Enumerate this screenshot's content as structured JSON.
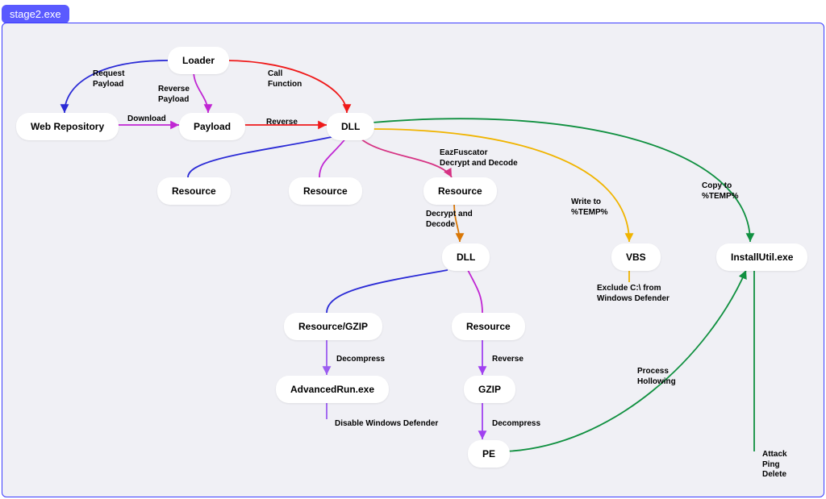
{
  "title": "stage2.exe",
  "nodes": {
    "loader": "Loader",
    "webrepo": "Web Repository",
    "payload": "Payload",
    "dll1": "DLL",
    "res1": "Resource",
    "res2": "Resource",
    "res3": "Resource",
    "dll2": "DLL",
    "resgzip": "Resource/GZIP",
    "res4": "Resource",
    "advrun": "AdvancedRun.exe",
    "gzip": "GZIP",
    "pe": "PE",
    "vbs": "VBS",
    "installutil": "InstallUtil.exe"
  },
  "edgeLabels": {
    "reqPayload": "Request\nPayload",
    "revPayload": "Reverse\nPayload",
    "callFunc": "Call\nFunction",
    "download": "Download",
    "reverse": "Reverse",
    "eaz": "EazFuscator\nDecrypt and Decode",
    "writeTemp": "Write to\n%TEMP%",
    "copyTemp": "Copy to\n%TEMP%",
    "decDec": "Decrypt and\nDecode",
    "excludeC": "Exclude C:\\ from\nWindows Defender",
    "decompress1": "Decompress",
    "reverse2": "Reverse",
    "disableWD": "Disable Windows Defender",
    "decompress2": "Decompress",
    "procHollow": "Process\nHollowing",
    "apd": "Attack\nPing\nDelete"
  }
}
